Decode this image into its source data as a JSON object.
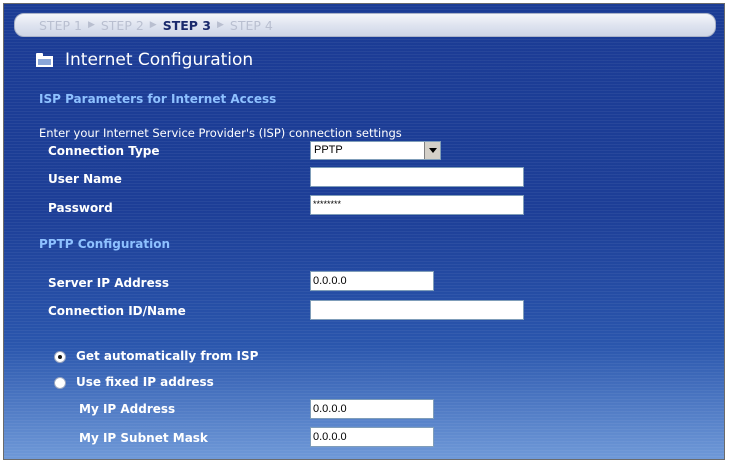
{
  "steps": [
    {
      "label": "STEP 1",
      "active": false
    },
    {
      "label": "STEP 2",
      "active": false
    },
    {
      "label": "STEP 3",
      "active": true
    },
    {
      "label": "STEP 4",
      "active": false
    }
  ],
  "step_separator": "▶",
  "page_title": "Internet Configuration",
  "isp_section": {
    "title": "ISP Parameters for Internet Access",
    "description": "Enter your Internet Service Provider's (ISP) connection settings",
    "connection_type_label": "Connection Type",
    "connection_type_value": "PPTP",
    "user_name_label": "User Name",
    "user_name_value": "",
    "password_label": "Password",
    "password_value": "********"
  },
  "pptp_section": {
    "title": "PPTP Configuration",
    "server_ip_label": "Server IP Address",
    "server_ip_value": "0.0.0.0",
    "connection_id_label": "Connection ID/Name",
    "connection_id_value": ""
  },
  "ip_options": {
    "auto_label": "Get automatically from ISP",
    "auto_selected": true,
    "fixed_label": "Use fixed IP address",
    "fixed_selected": false,
    "my_ip_label": "My IP Address",
    "my_ip_value": "0.0.0.0",
    "subnet_label": "My IP Subnet Mask",
    "subnet_value": "0.0.0.0"
  },
  "icons": {
    "title_icon": "folder-icon",
    "dropdown_icon": "chevron-down-icon"
  },
  "colors": {
    "background_top": "#1b3c95",
    "background_bottom": "#6f99d8",
    "section_heading": "#8ec1ff",
    "active_step": "#1a2a6c",
    "inactive_step": "#b9bfd0"
  }
}
